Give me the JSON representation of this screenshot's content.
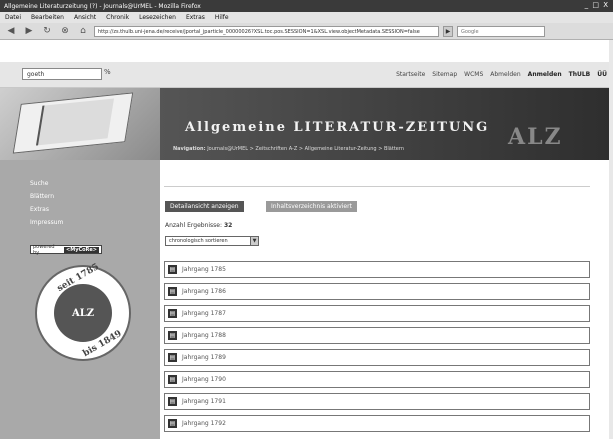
{
  "browser": {
    "title": "Allgemeine Literaturzeitung (?) - Journals@UrMEL - Mozilla Firefox",
    "controls": "_ □ X",
    "menu": [
      "Datei",
      "Bearbeiten",
      "Ansicht",
      "Chronik",
      "Lesezeichen",
      "Extras",
      "Hilfe"
    ],
    "url": "http://zs.thulb.uni-jena.de/receive/jportal_jparticle_00000026?XSL.toc.pos.SESSION=1&XSL.view.objectMetadata.SESSION=false",
    "search_placeholder": "Google",
    "go_label": "▶"
  },
  "site": {
    "search_value": "goeth",
    "search_btn": "%",
    "toplinks": [
      "Startseite",
      "Sitemap",
      "WCMS",
      "Abmelden",
      "Anmelden",
      "ThULB",
      "ÜÜ"
    ],
    "title": "Allgemeine LITERATUR-ZEITUNG",
    "alz": "ALZ",
    "breadcrumb_label": "Navigation:",
    "breadcrumb": "Journals@UrMEL > Zeitschriften A-Z > Allgemeine Literatur-Zeitung > Blättern"
  },
  "sidebar": {
    "items": [
      "Suche",
      "Blättern",
      "Extras",
      "Impressum"
    ],
    "powered_label": "powered by",
    "powered_brand": "<MyCoRe>",
    "seal_top": "seit 1785",
    "seal_center": "ALZ",
    "seal_bottom": "bis 1849"
  },
  "main": {
    "btn_detail": "Detailansicht anzeigen",
    "btn_toc": "Inhaltsverzeichnis aktiviert",
    "count_label": "Anzahl Ergebnisse:",
    "count_value": "32",
    "sort_label": "chronologisch sortieren",
    "items": [
      "Jahrgang 1785",
      "Jahrgang 1786",
      "Jahrgang 1787",
      "Jahrgang 1788",
      "Jahrgang 1789",
      "Jahrgang 1790",
      "Jahrgang 1791",
      "Jahrgang 1792"
    ]
  }
}
